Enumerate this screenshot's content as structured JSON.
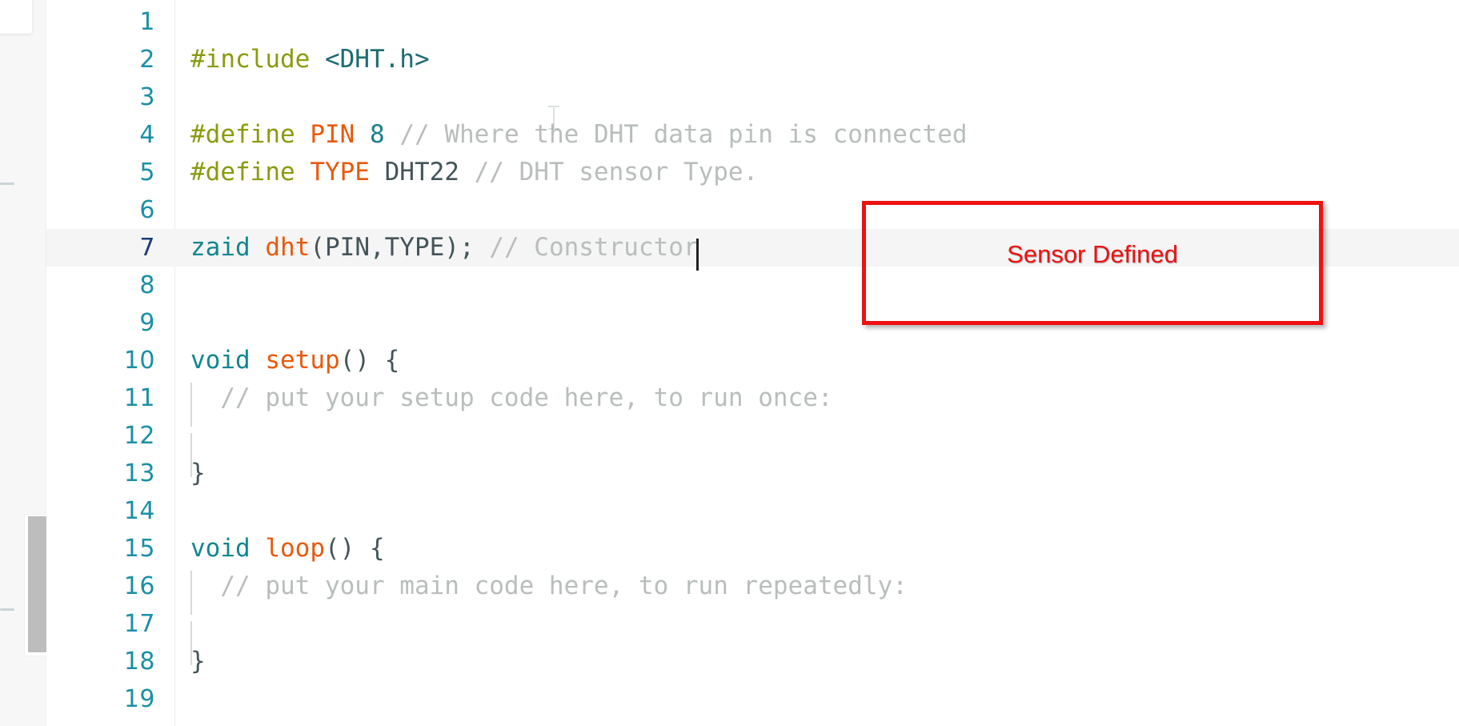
{
  "editor": {
    "language": "arduino-cpp",
    "active_line": 7,
    "gutter_color": "#1a8fa6",
    "active_gutter_color": "#1c3b7a",
    "active_line_bg": "#f5f5f5",
    "lines": [
      {
        "n": "1",
        "text": ""
      },
      {
        "n": "2",
        "text": "#include <DHT.h>"
      },
      {
        "n": "3",
        "text": ""
      },
      {
        "n": "4",
        "text": "#define PIN 8 // Where the DHT data pin is connected"
      },
      {
        "n": "5",
        "text": "#define TYPE DHT22 // DHT sensor Type."
      },
      {
        "n": "6",
        "text": ""
      },
      {
        "n": "7",
        "text": "zaid dht(PIN,TYPE); // Constructor"
      },
      {
        "n": "8",
        "text": ""
      },
      {
        "n": "9",
        "text": ""
      },
      {
        "n": "10",
        "text": "void setup() {"
      },
      {
        "n": "11",
        "text": "  // put your setup code here, to run once:"
      },
      {
        "n": "12",
        "text": ""
      },
      {
        "n": "13",
        "text": "}"
      },
      {
        "n": "14",
        "text": ""
      },
      {
        "n": "15",
        "text": "void loop() {"
      },
      {
        "n": "16",
        "text": "  // put your main code here, to run repeatedly:"
      },
      {
        "n": "17",
        "text": ""
      },
      {
        "n": "18",
        "text": "}"
      },
      {
        "n": "19",
        "text": ""
      }
    ],
    "tokens": {
      "l2": [
        {
          "s": "#include ",
          "c": "t-pre"
        },
        {
          "s": "<DHT.h>",
          "c": "t-inc"
        }
      ],
      "l4": [
        {
          "s": "#define ",
          "c": "t-pre"
        },
        {
          "s": "PIN",
          "c": "t-macro"
        },
        {
          "s": " ",
          "c": "t-plain"
        },
        {
          "s": "8",
          "c": "t-num"
        },
        {
          "s": " ",
          "c": "t-plain"
        },
        {
          "s": "// Where the DHT data pin is connected",
          "c": "t-com"
        }
      ],
      "l5": [
        {
          "s": "#define ",
          "c": "t-pre"
        },
        {
          "s": "TYPE",
          "c": "t-macro"
        },
        {
          "s": " DHT22 ",
          "c": "t-plain"
        },
        {
          "s": "// DHT sensor Type.",
          "c": "t-com"
        }
      ],
      "l7": [
        {
          "s": "zaid ",
          "c": "t-kw"
        },
        {
          "s": "dht",
          "c": "t-fn"
        },
        {
          "s": "(PIN,TYPE); ",
          "c": "t-plain"
        },
        {
          "s": "// Constructor",
          "c": "t-com"
        }
      ],
      "l10": [
        {
          "s": "void",
          "c": "t-kw"
        },
        {
          "s": " ",
          "c": "t-plain"
        },
        {
          "s": "setup",
          "c": "t-fn"
        },
        {
          "s": "() {",
          "c": "t-brace"
        }
      ],
      "l11": [
        {
          "s": "  // put your setup code here, to run once:",
          "c": "t-com"
        }
      ],
      "l13": [
        {
          "s": "}",
          "c": "t-brace"
        }
      ],
      "l15": [
        {
          "s": "void",
          "c": "t-kw"
        },
        {
          "s": " ",
          "c": "t-plain"
        },
        {
          "s": "loop",
          "c": "t-fn"
        },
        {
          "s": "() {",
          "c": "t-brace"
        }
      ],
      "l16": [
        {
          "s": "  // put your main code here, to run repeatedly:",
          "c": "t-com"
        }
      ],
      "l18": [
        {
          "s": "}",
          "c": "t-brace"
        }
      ]
    }
  },
  "annotation": {
    "label": "Sensor Defined",
    "color": "#ee1111"
  }
}
